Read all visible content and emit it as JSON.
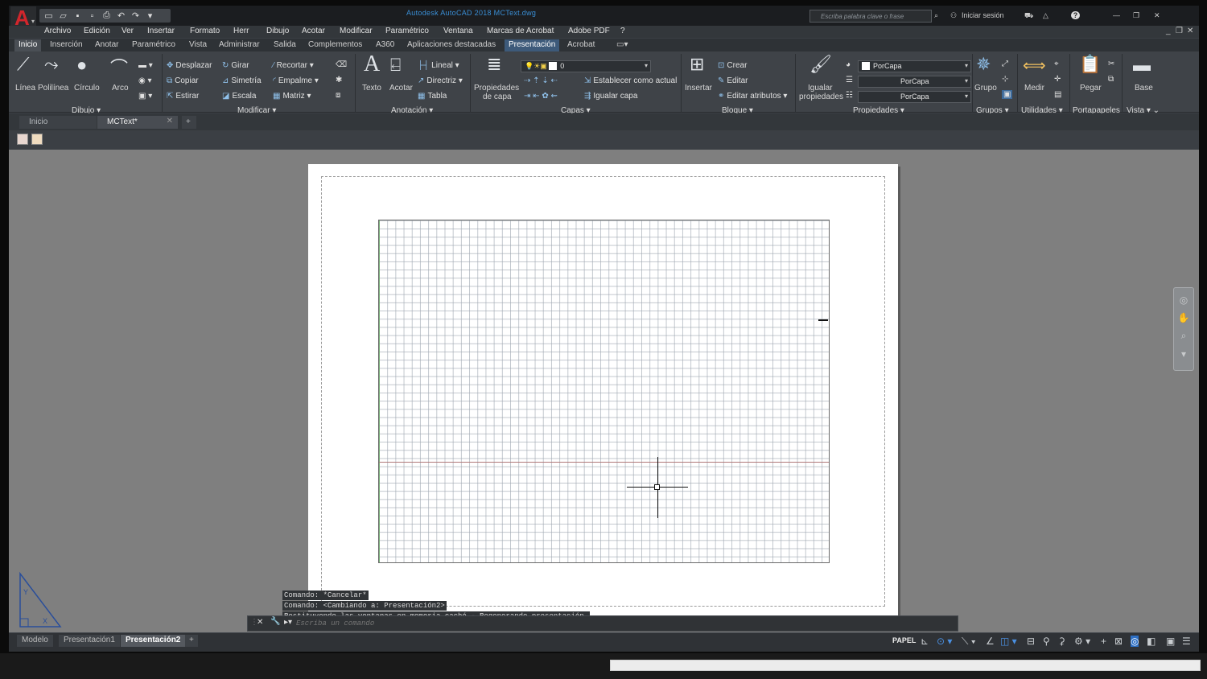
{
  "title_bar": {
    "app_title": "Autodesk AutoCAD 2018    MCText.dwg",
    "search_placeholder": "Escriba palabra clave o frase",
    "sign_in": "Iniciar sesión",
    "help": "?"
  },
  "menu": [
    "Archivo",
    "Edición",
    "Ver",
    "Insertar",
    "Formato",
    "Herr",
    "Dibujo",
    "Acotar",
    "Modificar",
    "Paramétrico",
    "Ventana",
    "Marcas de Acrobat",
    "Adobe PDF",
    "?"
  ],
  "ribbon_tabs": [
    "Inicio",
    "Inserción",
    "Anotar",
    "Paramétrico",
    "Vista",
    "Administrar",
    "Salida",
    "Complementos",
    "A360",
    "Aplicaciones destacadas",
    "Presentación",
    "Acrobat"
  ],
  "ribbon": {
    "dibujo": {
      "title": "Dibujo",
      "linea": "Línea",
      "polilinea": "Polilínea",
      "circulo": "Círculo",
      "arco": "Arco"
    },
    "modificar": {
      "title": "Modificar",
      "desplazar": "Desplazar",
      "girar": "Girar",
      "recortar": "Recortar",
      "copiar": "Copiar",
      "simetria": "Simetría",
      "empalme": "Empalme",
      "estirar": "Estirar",
      "escala": "Escala",
      "matriz": "Matriz"
    },
    "anotacion": {
      "title": "Anotación",
      "texto": "Texto",
      "acotar": "Acotar",
      "lineal": "Lineal",
      "directriz": "Directriz",
      "tabla": "Tabla"
    },
    "capas": {
      "title": "Capas",
      "propiedades": "Propiedades",
      "de_capa": "de capa",
      "layer_value": "0",
      "establecer": "Establecer como actual",
      "igualar_capa": "Igualar capa"
    },
    "bloque": {
      "title": "Bloque",
      "insertar": "Insertar",
      "crear": "Crear",
      "editar": "Editar",
      "editar_atributos": "Editar atributos"
    },
    "propiedades": {
      "title": "Propiedades",
      "igualar": "Igualar",
      "propiedades": "propiedades",
      "color": "PorCapa",
      "linetype": "PorCapa",
      "lineweight": "PorCapa"
    },
    "grupos": {
      "title": "Grupos",
      "grupo": "Grupo"
    },
    "utilidades": {
      "title": "Utilidades",
      "medir": "Medir"
    },
    "portapapeles": {
      "title": "Portapapeles",
      "pegar": "Pegar"
    },
    "vista": {
      "title": "Vista",
      "base": "Base"
    }
  },
  "doc_tabs": [
    "Inicio",
    "MCText*"
  ],
  "command_history": [
    "Comando: *Cancelar*",
    "Comando:   <Cambiando a: Presentación2>",
    "Restituyendo las ventanas en memoria caché - Regenerando presentación."
  ],
  "command_placeholder": "Escriba un comando",
  "layout_tabs": [
    "Modelo",
    "Presentación1",
    "Presentación2"
  ],
  "status": {
    "space": "PAPEL"
  }
}
